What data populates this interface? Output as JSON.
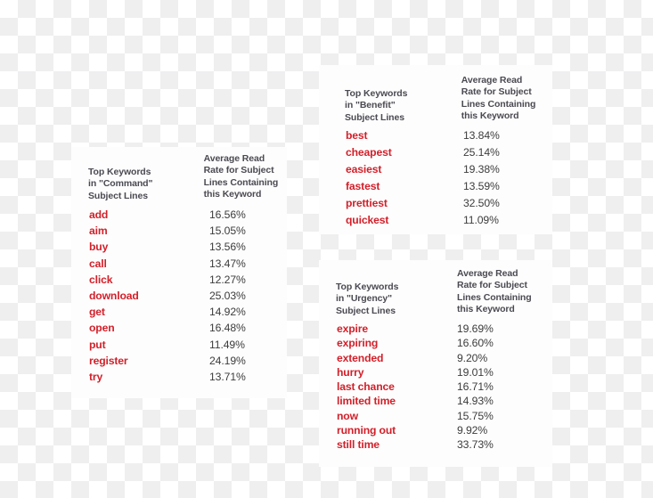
{
  "theme": {
    "keyword_color": "#d3202a",
    "header_color": "#4a4a52",
    "value_color": "#3c3c3c",
    "card_background": "#fdfdfd",
    "checker_light": "#ffffff",
    "checker_dark": "#efeff0"
  },
  "cards": [
    {
      "id": "command",
      "headers": {
        "keyword": "Top Keywords\nin \"Command\"\nSubject Lines",
        "value": "Average Read\nRate for Subject\nLines Containing\nthis Keyword"
      },
      "rows": [
        {
          "keyword": "add",
          "value": "16.56%"
        },
        {
          "keyword": "aim",
          "value": "15.05%"
        },
        {
          "keyword": "buy",
          "value": "13.56%"
        },
        {
          "keyword": "call",
          "value": "13.47%"
        },
        {
          "keyword": "click",
          "value": "12.27%"
        },
        {
          "keyword": "download",
          "value": "25.03%"
        },
        {
          "keyword": "get",
          "value": "14.92%"
        },
        {
          "keyword": "open",
          "value": "16.48%"
        },
        {
          "keyword": "put",
          "value": "11.49%"
        },
        {
          "keyword": "register",
          "value": "24.19%"
        },
        {
          "keyword": "try",
          "value": "13.71%"
        }
      ]
    },
    {
      "id": "benefit",
      "headers": {
        "keyword": "Top Keywords\nin \"Benefit\"\nSubject Lines",
        "value": "Average Read\nRate for Subject\nLines Containing\nthis Keyword"
      },
      "rows": [
        {
          "keyword": "best",
          "value": "13.84%"
        },
        {
          "keyword": "cheapest",
          "value": "25.14%"
        },
        {
          "keyword": "easiest",
          "value": "19.38%"
        },
        {
          "keyword": "fastest",
          "value": "13.59%"
        },
        {
          "keyword": "prettiest",
          "value": "32.50%"
        },
        {
          "keyword": "quickest",
          "value": "11.09%"
        }
      ]
    },
    {
      "id": "urgency",
      "headers": {
        "keyword": "Top Keywords\nin \"Urgency\"\nSubject Lines",
        "value": "Average Read\nRate for Subject\nLines Containing\nthis Keyword"
      },
      "rows": [
        {
          "keyword": "expire",
          "value": "19.69%"
        },
        {
          "keyword": "expiring",
          "value": "16.60%"
        },
        {
          "keyword": "extended",
          "value": "9.20%"
        },
        {
          "keyword": "hurry",
          "value": "19.01%"
        },
        {
          "keyword": "last chance",
          "value": "16.71%"
        },
        {
          "keyword": "limited time",
          "value": "14.93%"
        },
        {
          "keyword": "now",
          "value": "15.75%"
        },
        {
          "keyword": "running out",
          "value": "9.92%"
        },
        {
          "keyword": "still time",
          "value": "33.73%"
        }
      ]
    }
  ]
}
